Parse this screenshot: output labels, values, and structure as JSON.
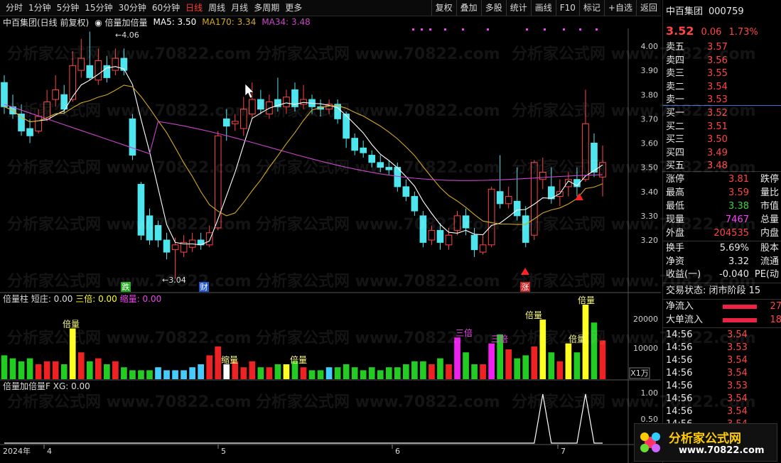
{
  "app": {
    "periods": [
      "分时",
      "1分钟",
      "5分钟",
      "15分钟",
      "30分钟",
      "60分钟",
      "日线",
      "周线",
      "月线",
      "多周期",
      "更多"
    ],
    "active_period": "日线",
    "tools": [
      "复权",
      "叠加",
      "多股",
      "统计",
      "画线",
      "F10",
      "标记",
      "+自选",
      "返回"
    ]
  },
  "chart_info": {
    "stock": "中百集团(日线 前复权)",
    "indicator": "倍量加倍量",
    "ma5": "MA5: 3.50",
    "ma170": "MA170: 3.34",
    "ma34": "MA34: 3.48"
  },
  "main_axis": {
    "ticks": [
      "4.00",
      "3.90",
      "3.80",
      "3.70",
      "3.60",
      "3.50",
      "3.40",
      "3.30",
      "3.20"
    ]
  },
  "main_annotations": {
    "high": "4.06",
    "low": "3.04",
    "m1": "跌",
    "m2": "财",
    "m3": "涨"
  },
  "vol_panel": {
    "title": "倍量柱",
    "short": "短庄: 0.00",
    "triple": "三倍: 0.00",
    "shrink": "缩量: 0.00",
    "ticks": [
      "20000",
      "10000"
    ],
    "unit": "X1万",
    "labels": [
      "倍量",
      "缩量",
      "倍量",
      "三倍",
      "三倍",
      "倍量",
      "倍量",
      "倍量"
    ]
  },
  "xg_panel": {
    "title": "倍量加倍量F",
    "xg": "XG: 0.00",
    "ticks": [
      "1.00",
      "0.50"
    ]
  },
  "x_axis": {
    "labels": [
      "2024年",
      "4",
      "5",
      "6",
      "7"
    ]
  },
  "quote": {
    "name": "中百集团",
    "code": "000759",
    "price": "3.52",
    "change": "0.06",
    "pct": "1.73%",
    "asks": [
      {
        "label": "卖五",
        "price": "3.57"
      },
      {
        "label": "卖四",
        "price": "3.56"
      },
      {
        "label": "卖三",
        "price": "3.55"
      },
      {
        "label": "卖二",
        "price": "3.54"
      },
      {
        "label": "卖一",
        "price": "3.53"
      }
    ],
    "bids": [
      {
        "label": "买一",
        "price": "3.52"
      },
      {
        "label": "买二",
        "price": "3.51"
      },
      {
        "label": "买三",
        "price": "3.50"
      },
      {
        "label": "买四",
        "price": "3.49"
      },
      {
        "label": "买五",
        "price": "3.48"
      }
    ],
    "stats": [
      {
        "l": "涨停",
        "v": "3.81",
        "r": "跌停"
      },
      {
        "l": "最高",
        "v": "3.59",
        "r": "量比"
      },
      {
        "l": "最低",
        "v": "3.38",
        "r": "市值"
      },
      {
        "l": "现量",
        "v": "7467",
        "r": "总量"
      },
      {
        "l": "外盘",
        "v": "204535",
        "r": "内盘"
      }
    ],
    "stats2": [
      {
        "l": "换手",
        "v": "5.69%",
        "r": "股本"
      },
      {
        "l": "净资",
        "v": "3.32",
        "r": "流通"
      },
      {
        "l": "收益(一)",
        "v": "-0.040",
        "r": "PE(动"
      }
    ],
    "trade_state": "交易状态: 闭市阶段 15",
    "flows": [
      {
        "l": "净流入",
        "v": "27"
      },
      {
        "l": "大单流入",
        "v": "18"
      }
    ],
    "ticks": [
      {
        "t": "14:56",
        "p": "3.54"
      },
      {
        "t": "14:56",
        "p": "3.53"
      },
      {
        "t": "14:56",
        "p": "3.54"
      },
      {
        "t": "14:56",
        "p": "3.54"
      },
      {
        "t": "14:56",
        "p": "3.53"
      },
      {
        "t": "14:56",
        "p": "3.54"
      },
      {
        "t": "14:56",
        "p": "3.54"
      },
      {
        "t": "14:56",
        "p": "3.54"
      }
    ]
  },
  "watermark": "分析家公式网 www.70822.com",
  "logo": {
    "title": "分析家公式网",
    "url": "www.70822.com"
  },
  "colors": {
    "up": "#ff4545",
    "down": "#4ee6ee",
    "ma5": "#ffffff",
    "ma34": "#cc44cc",
    "ma170": "#d4a81a",
    "vol_green": "#22cc22",
    "vol_red": "#ee2222",
    "vol_yellow": "#ffff22",
    "vol_magenta": "#ee22ee"
  }
}
